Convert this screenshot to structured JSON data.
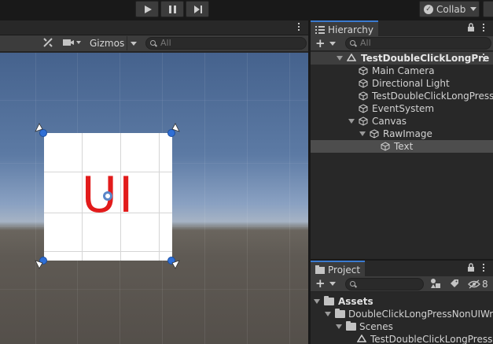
{
  "toolbar": {
    "collab_label": "Collab"
  },
  "scene": {
    "gizmos_label": "Gizmos",
    "search_placeholder": "All",
    "ui_text": "UI"
  },
  "hierarchy": {
    "tab_label": "Hierarchy",
    "search_placeholder": "All",
    "rows": [
      {
        "label": "TestDoubleClickLongPre",
        "icon": "unity-scene-icon",
        "scene": true
      },
      {
        "label": "Main Camera",
        "icon": "cube-icon"
      },
      {
        "label": "Directional Light",
        "icon": "cube-icon"
      },
      {
        "label": "TestDoubleClickLongPress",
        "icon": "cube-icon"
      },
      {
        "label": "EventSystem",
        "icon": "cube-icon"
      },
      {
        "label": "Canvas",
        "icon": "cube-icon"
      },
      {
        "label": "RawImage",
        "icon": "cube-icon"
      },
      {
        "label": "Text",
        "icon": "cube-icon",
        "selected": true
      }
    ]
  },
  "project": {
    "tab_label": "Project",
    "hidden_count": "8",
    "rows": [
      {
        "label": "Assets",
        "icon": "folder-icon"
      },
      {
        "label": "DoubleClickLongPressNonUIWra",
        "icon": "folder-icon"
      },
      {
        "label": "Scenes",
        "icon": "folder-icon"
      },
      {
        "label": "TestDoubleClickLongPress",
        "icon": "unity-scene-icon"
      }
    ]
  },
  "colors": {
    "accent": "#3a7ad0",
    "ui_text": "#e21b1b",
    "handle": "#2f6fd6"
  }
}
